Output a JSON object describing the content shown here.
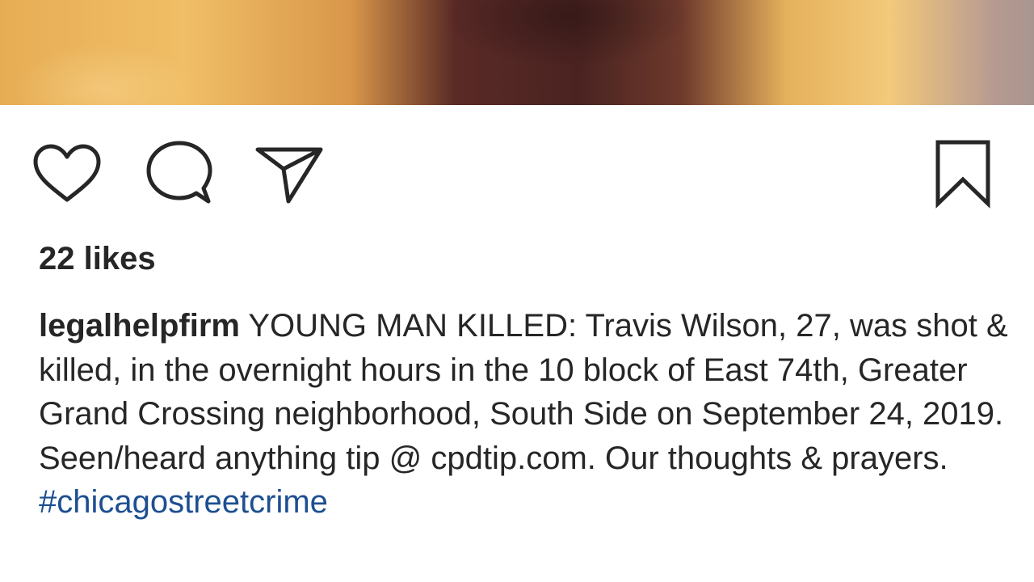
{
  "post": {
    "likes_text": "22 likes",
    "username": "legalhelpfirm",
    "caption_text": " YOUNG MAN KILLED: Travis Wilson, 27, was shot & killed, in the overnight hours in the 10 block of East 74th, Greater Grand Crossing neighborhood, South Side on September 24, 2019. Seen/heard anything tip @ cpdtip.com. Our thoughts & prayers. ",
    "hashtag": "#chicagostreetcrime"
  },
  "actions": {
    "icons": [
      "heart-icon",
      "comment-icon",
      "share-icon",
      "bookmark-icon"
    ]
  },
  "colors": {
    "text": "#262626",
    "hashtag": "#1d4f91",
    "background": "#ffffff"
  }
}
